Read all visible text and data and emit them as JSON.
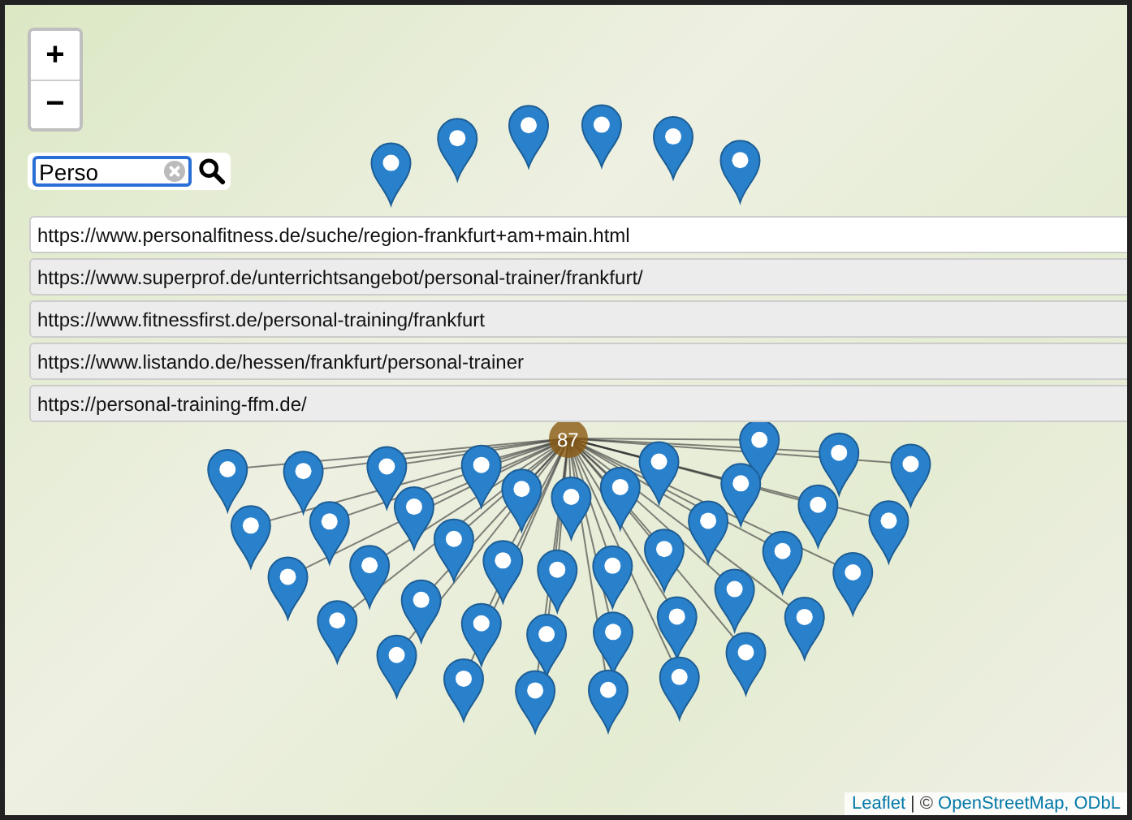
{
  "map": {
    "zoom_controls": [
      {
        "label": "+"
      },
      {
        "label": "−"
      }
    ],
    "search": {
      "value": "Perso"
    },
    "suggestions": [
      {
        "url": "https://www.personalfitness.de/suche/region-frankfurt+am+main.html",
        "selected": true
      },
      {
        "url": "https://www.superprof.de/unterrichtsangebot/personal-trainer/frankfurt/",
        "selected": false
      },
      {
        "url": "https://www.fitnessfirst.de/personal-training/frankfurt",
        "selected": false
      },
      {
        "url": "https://www.listando.de/hessen/frankfurt/personal-trainer",
        "selected": false
      },
      {
        "url": "https://personal-training-ffm.de/",
        "selected": false
      }
    ],
    "cluster": {
      "count": "87"
    },
    "attribution": [
      {
        "kind": "link",
        "text": "Leaflet"
      },
      {
        "kind": "text",
        "text": "| ©"
      },
      {
        "kind": "link",
        "text": "OpenStreetMap,"
      },
      {
        "kind": "link",
        "text": "ODbL"
      }
    ]
  }
}
